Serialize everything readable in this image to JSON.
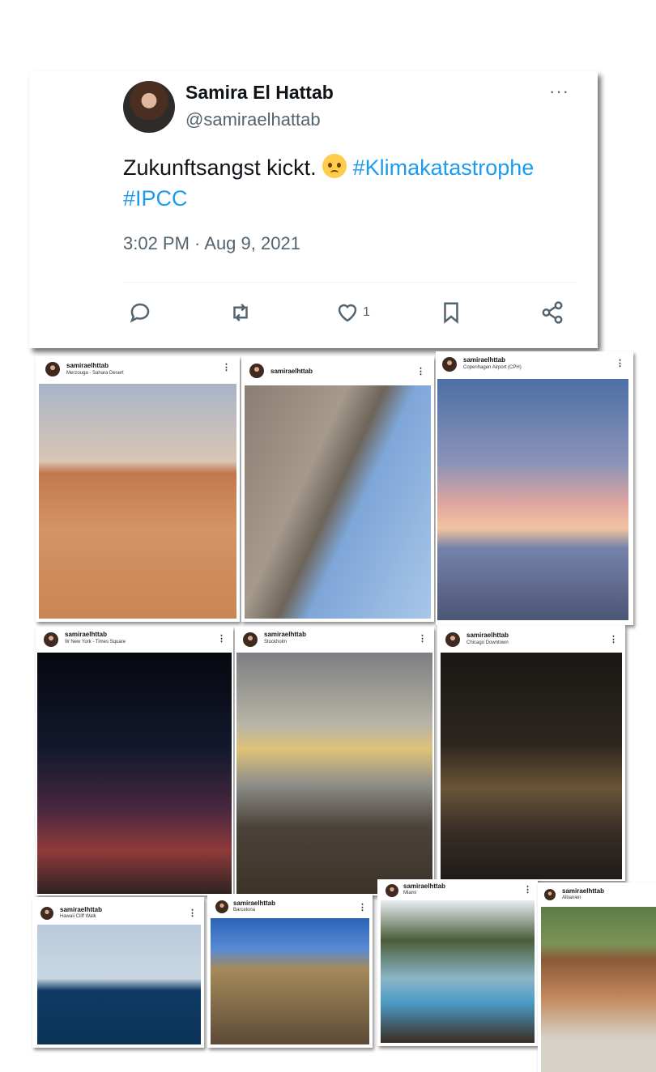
{
  "tweet": {
    "name": "Samira El Hattab",
    "handle": "@samiraelhattab",
    "text_plain": "Zukunftsangst kickt.",
    "emoji": "pleading-face",
    "hashtag1": "#Klimakatastrophe",
    "hashtag2": "#IPCC",
    "timestamp": "3:02 PM · Aug 9, 2021",
    "like_count": "1",
    "more_label": "···"
  },
  "posts": [
    {
      "username": "samiraelhttab",
      "location": "Merzouga - Sahara Desert"
    },
    {
      "username": "samiraelhttab",
      "location": ""
    },
    {
      "username": "samiraelhttab",
      "location": "Copenhagen Airport (CPH)"
    },
    {
      "username": "samiraelhttab",
      "location": "W New York - Times Square"
    },
    {
      "username": "samiraelhttab",
      "location": "Stockholm"
    },
    {
      "username": "samiraelhttab",
      "location": "Chicago Downtown"
    },
    {
      "username": "samiraelhttab",
      "location": "Hawaii Cliff Walk"
    },
    {
      "username": "samiraelhttab",
      "location": "Barcelona"
    },
    {
      "username": "samiraelhttab",
      "location": "Miami"
    },
    {
      "username": "samiraelhttab",
      "location": "Albanien"
    }
  ],
  "dots_label": "⋮",
  "colors": {
    "hashtag": "#1d9bf0",
    "muted": "#536471",
    "text": "#0f1419"
  }
}
